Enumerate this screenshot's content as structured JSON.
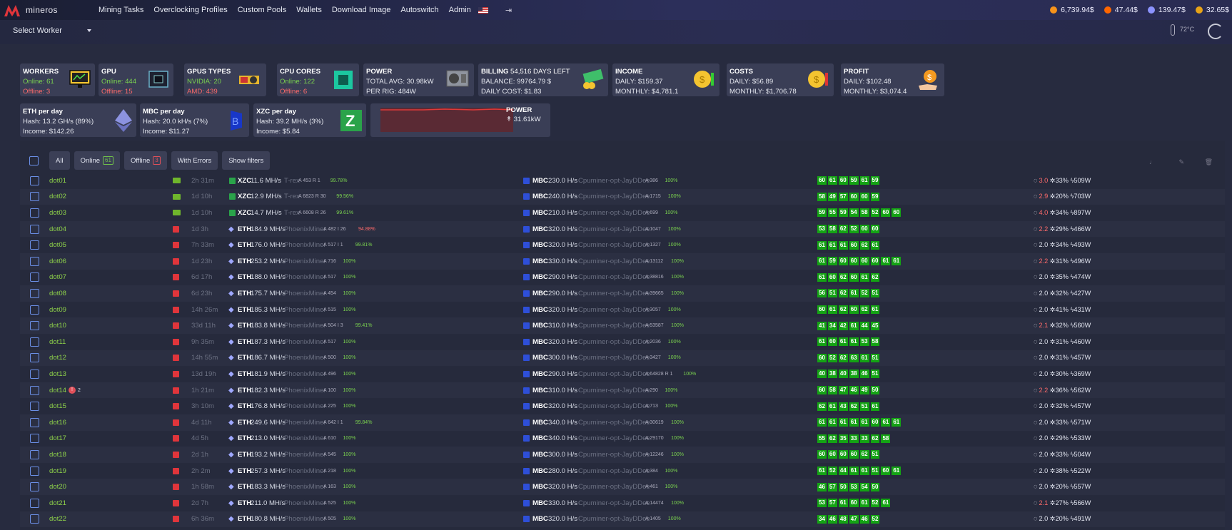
{
  "app": {
    "logo": "mineros"
  },
  "nav": [
    "Mining Tasks",
    "Overclocking Profiles",
    "Custom Pools",
    "Wallets",
    "Download Image",
    "Autoswitch",
    "Admin"
  ],
  "coins": [
    {
      "value": "6,739.94$",
      "color": "#f7931a",
      "icon": "bitcoin-icon"
    },
    {
      "value": "47.44$",
      "color": "#ff6600",
      "icon": "monero-icon"
    },
    {
      "value": "139.47$",
      "color": "#8c93ff",
      "icon": "ethereum-icon"
    },
    {
      "value": "32.65$",
      "color": "#e8a317",
      "icon": "zcash-icon"
    }
  ],
  "subbar": {
    "select_worker": "Select Worker",
    "temperature": "72°C"
  },
  "cards": {
    "workers": {
      "title": "WORKERS",
      "online": "Online: 61",
      "offline": "Offline: 3"
    },
    "gpu": {
      "title": "GPU",
      "online": "Online: 444",
      "offline": "Offline: 15"
    },
    "gpu_types": {
      "title": "GPUS TYPES",
      "nvidia": "NVIDIA: 20",
      "amd": "AMD: 439"
    },
    "cpu_cores": {
      "title": "CPU CORES",
      "online": "Online: 122",
      "offline": "Offline: 6"
    },
    "power": {
      "title": "POWER",
      "total": "TOTAL AVG: 30.98kW",
      "per_rig": "PER RIG: 484W"
    },
    "billing": {
      "title": "BILLING",
      "days_left": "54,516 DAYS LEFT",
      "balance": "BALANCE: 99764.79 $",
      "daily": "DAILY COST: $1.83"
    },
    "income": {
      "title": "INCOME",
      "daily": "DAILY: $159.37",
      "monthly": "MONTHLY: $4,781.1"
    },
    "costs": {
      "title": "COSTS",
      "daily": "DAILY: $56.89",
      "monthly": "MONTHLY: $1,706.78"
    },
    "profit": {
      "title": "PROFIT",
      "daily": "DAILY: $102.48",
      "monthly": "MONTHLY: $3,074.4"
    },
    "eth": {
      "title": "ETH per day",
      "hash": "Hash: 13.2 GH/s (89%)",
      "income": "Income: $142.26"
    },
    "mbc": {
      "title": "MBC per day",
      "hash": "Hash: 20.0 kH/s (7%)",
      "income": "Income: $11.27"
    },
    "xzc": {
      "title": "XZC per day",
      "hash": "Hash: 39.2 MH/s (3%)",
      "income": "Income: $5.84"
    },
    "power_chart": {
      "title": "POWER",
      "value": "31.61kW"
    }
  },
  "filters": {
    "all": "All",
    "online": "Online",
    "online_count": "61",
    "offline": "Offline",
    "offline_count": "3",
    "errors": "With Errors",
    "show": "Show filters"
  },
  "rows": [
    {
      "name": "dot01",
      "time": "2h 31m",
      "gpu": "nvidia",
      "coin": "XZC",
      "hash": "11.6 MH/s",
      "miner": "T-rex",
      "acc": "A 453 R 1",
      "pct": "99.78%",
      "coin2": "MBC",
      "hash2": "230.0 H/s",
      "miner2": "Cpuminer-opt-JayDDee",
      "acc2": "A 386",
      "pct2": "100%",
      "temps": [
        "60",
        "61",
        "60",
        "59",
        "61",
        "59"
      ],
      "fail": "3.0",
      "fan": "33%",
      "power": "509W"
    },
    {
      "name": "dot02",
      "time": "1d 10h",
      "gpu": "nvidia",
      "coin": "XZC",
      "hash": "12.9 MH/s",
      "miner": "T-rex",
      "acc": "A 6823 R 30",
      "pct": "99.56%",
      "coin2": "MBC",
      "hash2": "240.0 H/s",
      "miner2": "Cpuminer-opt-JayDDee",
      "acc2": "A 1715",
      "pct2": "100%",
      "temps": [
        "58",
        "49",
        "57",
        "60",
        "60",
        "59"
      ],
      "fail": "2.9",
      "fan": "20%",
      "power": "703W"
    },
    {
      "name": "dot03",
      "time": "1d 10h",
      "gpu": "nvidia",
      "coin": "XZC",
      "hash": "14.7 MH/s",
      "miner": "T-rex",
      "acc": "A 6608 R 26",
      "pct": "99.61%",
      "coin2": "MBC",
      "hash2": "210.0 H/s",
      "miner2": "Cpuminer-opt-JayDDee",
      "acc2": "A 699",
      "pct2": "100%",
      "temps": [
        "59",
        "55",
        "59",
        "54",
        "58",
        "52",
        "60",
        "60"
      ],
      "fail": "4.0",
      "fan": "34%",
      "power": "897W"
    },
    {
      "name": "dot04",
      "time": "1d 3h",
      "gpu": "amd",
      "coin": "ETH",
      "hash": "184.9 MH/s",
      "miner": "PhoenixMiner",
      "acc": "A 482 I 26",
      "pct": "94.88%",
      "coin2": "MBC",
      "hash2": "320.0 H/s",
      "miner2": "Cpuminer-opt-JayDDee",
      "acc2": "A 1047",
      "pct2": "100%",
      "temps": [
        "53",
        "58",
        "62",
        "52",
        "60",
        "60"
      ],
      "fail": "2.2",
      "fan": "29%",
      "power": "466W"
    },
    {
      "name": "dot05",
      "time": "7h 33m",
      "gpu": "amd",
      "coin": "ETH",
      "hash": "176.0 MH/s",
      "miner": "PhoenixMiner",
      "acc": "A 517 I 1",
      "pct": "99.81%",
      "coin2": "MBC",
      "hash2": "320.0 H/s",
      "miner2": "Cpuminer-opt-JayDDee",
      "acc2": "A 1327",
      "pct2": "100%",
      "temps": [
        "61",
        "61",
        "61",
        "60",
        "62",
        "61"
      ],
      "fail": "2.0",
      "fan": "34%",
      "power": "493W"
    },
    {
      "name": "dot06",
      "time": "1d 23h",
      "gpu": "amd",
      "coin": "ETH",
      "hash": "253.2 MH/s",
      "miner": "PhoenixMiner",
      "acc": "A 716",
      "pct": "100%",
      "coin2": "MBC",
      "hash2": "330.0 H/s",
      "miner2": "Cpuminer-opt-JayDDee",
      "acc2": "A 13112",
      "pct2": "100%",
      "temps": [
        "61",
        "59",
        "60",
        "60",
        "60",
        "60",
        "61",
        "61"
      ],
      "fail": "2.2",
      "fan": "31%",
      "power": "496W"
    },
    {
      "name": "dot07",
      "time": "6d 17h",
      "gpu": "amd",
      "coin": "ETH",
      "hash": "188.0 MH/s",
      "miner": "PhoenixMiner",
      "acc": "A 517",
      "pct": "100%",
      "coin2": "MBC",
      "hash2": "290.0 H/s",
      "miner2": "Cpuminer-opt-JayDDee",
      "acc2": "A 38816",
      "pct2": "100%",
      "temps": [
        "61",
        "60",
        "62",
        "60",
        "61",
        "62"
      ],
      "fail": "2.0",
      "fan": "35%",
      "power": "474W"
    },
    {
      "name": "dot08",
      "time": "6d 23h",
      "gpu": "amd",
      "coin": "ETH",
      "hash": "175.7 MH/s",
      "miner": "PhoenixMiner",
      "acc": "A 454",
      "pct": "100%",
      "coin2": "MBC",
      "hash2": "290.0 H/s",
      "miner2": "Cpuminer-opt-JayDDee",
      "acc2": "A 39665",
      "pct2": "100%",
      "temps": [
        "56",
        "51",
        "62",
        "61",
        "52",
        "51"
      ],
      "fail": "2.0",
      "fan": "32%",
      "power": "427W"
    },
    {
      "name": "dot09",
      "time": "14h 26m",
      "gpu": "amd",
      "coin": "ETH",
      "hash": "185.3 MH/s",
      "miner": "PhoenixMiner",
      "acc": "A 515",
      "pct": "100%",
      "coin2": "MBC",
      "hash2": "320.0 H/s",
      "miner2": "Cpuminer-opt-JayDDee",
      "acc2": "A 3057",
      "pct2": "100%",
      "temps": [
        "60",
        "61",
        "62",
        "60",
        "62",
        "61"
      ],
      "fail": "2.0",
      "fan": "41%",
      "power": "431W"
    },
    {
      "name": "dot10",
      "time": "33d 11h",
      "gpu": "amd",
      "coin": "ETH",
      "hash": "183.8 MH/s",
      "miner": "PhoenixMiner",
      "acc": "A 504 I 3",
      "pct": "99.41%",
      "coin2": "MBC",
      "hash2": "310.0 H/s",
      "miner2": "Cpuminer-opt-JayDDee",
      "acc2": "A 53587",
      "pct2": "100%",
      "temps": [
        "41",
        "34",
        "42",
        "61",
        "44",
        "45"
      ],
      "fail": "2.1",
      "fan": "32%",
      "power": "560W"
    },
    {
      "name": "dot11",
      "time": "9h 35m",
      "gpu": "amd",
      "coin": "ETH",
      "hash": "187.3 MH/s",
      "miner": "PhoenixMiner",
      "acc": "A 517",
      "pct": "100%",
      "coin2": "MBC",
      "hash2": "320.0 H/s",
      "miner2": "Cpuminer-opt-JayDDee",
      "acc2": "A 2036",
      "pct2": "100%",
      "temps": [
        "61",
        "60",
        "61",
        "61",
        "53",
        "58"
      ],
      "fail": "2.0",
      "fan": "31%",
      "power": "460W"
    },
    {
      "name": "dot12",
      "time": "14h 55m",
      "gpu": "amd",
      "coin": "ETH",
      "hash": "186.7 MH/s",
      "miner": "PhoenixMiner",
      "acc": "A 500",
      "pct": "100%",
      "coin2": "MBC",
      "hash2": "300.0 H/s",
      "miner2": "Cpuminer-opt-JayDDee",
      "acc2": "A 3427",
      "pct2": "100%",
      "temps": [
        "60",
        "52",
        "62",
        "63",
        "61",
        "51"
      ],
      "fail": "2.0",
      "fan": "31%",
      "power": "457W"
    },
    {
      "name": "dot13",
      "time": "13d 19h",
      "gpu": "amd",
      "coin": "ETH",
      "hash": "181.9 MH/s",
      "miner": "PhoenixMiner",
      "acc": "A 496",
      "pct": "100%",
      "coin2": "MBC",
      "hash2": "290.0 H/s",
      "miner2": "Cpuminer-opt-JayDDee",
      "acc2": "A 64828 R 1",
      "pct2": "100%",
      "temps": [
        "40",
        "38",
        "40",
        "38",
        "46",
        "51"
      ],
      "fail": "2.0",
      "fan": "30%",
      "power": "369W"
    },
    {
      "name": "dot14",
      "time": "1h 21m",
      "gpu": "amd",
      "coin": "ETH",
      "hash": "182.3 MH/s",
      "miner": "PhoenixMiner",
      "acc": "A 100",
      "pct": "100%",
      "coin2": "MBC",
      "hash2": "310.0 H/s",
      "miner2": "Cpuminer-opt-JayDDee",
      "acc2": "A 290",
      "pct2": "100%",
      "temps": [
        "60",
        "58",
        "47",
        "46",
        "49",
        "50"
      ],
      "fail": "2.2",
      "fan": "36%",
      "power": "562W",
      "badge": "!",
      "badge2": "2"
    },
    {
      "name": "dot15",
      "time": "3h 10m",
      "gpu": "amd",
      "coin": "ETH",
      "hash": "176.8 MH/s",
      "miner": "PhoenixMiner",
      "acc": "A 225",
      "pct": "100%",
      "coin2": "MBC",
      "hash2": "320.0 H/s",
      "miner2": "Cpuminer-opt-JayDDee",
      "acc2": "A 713",
      "pct2": "100%",
      "temps": [
        "62",
        "61",
        "43",
        "62",
        "51",
        "61"
      ],
      "fail": "2.0",
      "fan": "32%",
      "power": "457W"
    },
    {
      "name": "dot16",
      "time": "4d 11h",
      "gpu": "amd",
      "coin": "ETH",
      "hash": "249.6 MH/s",
      "miner": "PhoenixMiner",
      "acc": "A 642 I 1",
      "pct": "99.84%",
      "coin2": "MBC",
      "hash2": "340.0 H/s",
      "miner2": "Cpuminer-opt-JayDDee",
      "acc2": "A 30619",
      "pct2": "100%",
      "temps": [
        "61",
        "61",
        "61",
        "61",
        "61",
        "60",
        "61",
        "61"
      ],
      "fail": "2.0",
      "fan": "33%",
      "power": "571W"
    },
    {
      "name": "dot17",
      "time": "4d 5h",
      "gpu": "amd",
      "coin": "ETH",
      "hash": "213.0 MH/s",
      "miner": "PhoenixMiner",
      "acc": "A 610",
      "pct": "100%",
      "coin2": "MBC",
      "hash2": "340.0 H/s",
      "miner2": "Cpuminer-opt-JayDDee",
      "acc2": "A 29170",
      "pct2": "100%",
      "temps": [
        "55",
        "62",
        "35",
        "33",
        "33",
        "62",
        "58"
      ],
      "fail": "2.0",
      "fan": "29%",
      "power": "533W"
    },
    {
      "name": "dot18",
      "time": "2d 1h",
      "gpu": "amd",
      "coin": "ETH",
      "hash": "193.2 MH/s",
      "miner": "PhoenixMiner",
      "acc": "A 545",
      "pct": "100%",
      "coin2": "MBC",
      "hash2": "300.0 H/s",
      "miner2": "Cpuminer-opt-JayDDee",
      "acc2": "A 12246",
      "pct2": "100%",
      "temps": [
        "60",
        "60",
        "60",
        "60",
        "62",
        "51"
      ],
      "fail": "2.0",
      "fan": "33%",
      "power": "504W"
    },
    {
      "name": "dot19",
      "time": "2h 2m",
      "gpu": "amd",
      "coin": "ETH",
      "hash": "257.3 MH/s",
      "miner": "PhoenixMiner",
      "acc": "A 218",
      "pct": "100%",
      "coin2": "MBC",
      "hash2": "280.0 H/s",
      "miner2": "Cpuminer-opt-JayDDee",
      "acc2": "A 384",
      "pct2": "100%",
      "temps": [
        "61",
        "52",
        "44",
        "61",
        "61",
        "51",
        "60",
        "61"
      ],
      "fail": "2.0",
      "fan": "38%",
      "power": "522W"
    },
    {
      "name": "dot20",
      "time": "1h 58m",
      "gpu": "amd",
      "coin": "ETH",
      "hash": "183.3 MH/s",
      "miner": "PhoenixMiner",
      "acc": "A 163",
      "pct": "100%",
      "coin2": "MBC",
      "hash2": "320.0 H/s",
      "miner2": "Cpuminer-opt-JayDDee",
      "acc2": "A 461",
      "pct2": "100%",
      "temps": [
        "46",
        "57",
        "50",
        "53",
        "54",
        "50"
      ],
      "fail": "2.0",
      "fan": "20%",
      "power": "557W"
    },
    {
      "name": "dot21",
      "time": "2d 7h",
      "gpu": "amd",
      "coin": "ETH",
      "hash": "211.0 MH/s",
      "miner": "PhoenixMiner",
      "acc": "A 525",
      "pct": "100%",
      "coin2": "MBC",
      "hash2": "330.0 H/s",
      "miner2": "Cpuminer-opt-JayDDee",
      "acc2": "A 14474",
      "pct2": "100%",
      "temps": [
        "53",
        "57",
        "61",
        "60",
        "61",
        "52",
        "61"
      ],
      "fail": "2.1",
      "fan": "27%",
      "power": "566W"
    },
    {
      "name": "dot22",
      "time": "6h 36m",
      "gpu": "amd",
      "coin": "ETH",
      "hash": "180.8 MH/s",
      "miner": "PhoenixMiner",
      "acc": "A 505",
      "pct": "100%",
      "coin2": "MBC",
      "hash2": "320.0 H/s",
      "miner2": "Cpuminer-opt-JayDDee",
      "acc2": "A 1405",
      "pct2": "100%",
      "temps": [
        "34",
        "46",
        "48",
        "47",
        "46",
        "52"
      ],
      "fail": "2.0",
      "fan": "20%",
      "power": "491W"
    }
  ]
}
